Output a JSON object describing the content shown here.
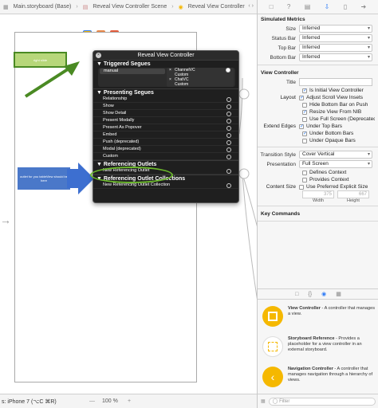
{
  "jumpbar": {
    "crumbs": [
      "Main.storyboard (Base)",
      "Reveal View Controller Scene",
      "Reveal View Controller"
    ]
  },
  "canvas": {
    "note_green": "right slide",
    "note_blue": "outlet for you tableView should be here"
  },
  "hud": {
    "title": "Reveal View Controller",
    "triggered_title": "Triggered Segues",
    "manual_label": "manual",
    "manual_targets": [
      {
        "mark": "×",
        "label": "ChannelVC"
      },
      {
        "mark": "",
        "label": "Custom"
      },
      {
        "mark": "×",
        "label": "ChatVC"
      },
      {
        "mark": "",
        "label": "Custom"
      }
    ],
    "presenting_title": "Presenting Segues",
    "presenting_items": [
      "Relationship",
      "Show",
      "Show Detail",
      "Present Modally",
      "Present As Popover",
      "Embed",
      "Push (deprecated)",
      "Modal (deprecated)",
      "Custom"
    ],
    "outlets_title": "Referencing Outlets",
    "outlets_items": [
      "New Referencing Outlet"
    ],
    "collections_title": "Referencing Outlet Collections",
    "collections_items": [
      "New Referencing Outlet Collection"
    ]
  },
  "bottombar": {
    "device": "s: iPhone 7 (⌥C ⌘R)",
    "zoom_out": "—",
    "zoom": "100 %",
    "zoom_in": "+"
  },
  "inspector": {
    "simulated_title": "Simulated Metrics",
    "metrics": [
      {
        "label": "Size",
        "value": "Inferred"
      },
      {
        "label": "Status Bar",
        "value": "Inferred"
      },
      {
        "label": "Top Bar",
        "value": "Inferred"
      },
      {
        "label": "Bottom Bar",
        "value": "Inferred"
      }
    ],
    "vc_title": "View Controller",
    "title_label": "Title",
    "is_initial": "Is Initial View Controller",
    "layout_label": "Layout",
    "layout_checks": [
      {
        "label": "Adjust Scroll View Insets",
        "checked": true
      },
      {
        "label": "Hide Bottom Bar on Push",
        "checked": false
      },
      {
        "label": "Resize View From NIB",
        "checked": true
      },
      {
        "label": "Use Full Screen (Deprecated)",
        "checked": false
      }
    ],
    "extend_label": "Extend Edges",
    "extend_checks": [
      {
        "label": "Under Top Bars",
        "checked": true
      },
      {
        "label": "Under Bottom Bars",
        "checked": true
      },
      {
        "label": "Under Opaque Bars",
        "checked": false
      }
    ],
    "transition_label": "Transition Style",
    "transition_value": "Cover Vertical",
    "presentation_label": "Presentation",
    "presentation_value": "Full Screen",
    "defines_context": "Defines Context",
    "provides_context": "Provides Context",
    "content_size_label": "Content Size",
    "use_preferred": "Use Preferred Explicit Size",
    "width_value": "375",
    "height_value": "667",
    "width_label": "Width",
    "height_label": "Height",
    "key_commands_title": "Key Commands"
  },
  "library": {
    "items": [
      {
        "name": "View Controller",
        "desc": " - A controller that manages a view."
      },
      {
        "name": "Storyboard Reference",
        "desc": " - Provides a placeholder for a view controller in an external storyboard."
      },
      {
        "name": "Navigation Controller",
        "desc": " - A controller that manages navigation through a hierarchy of views."
      }
    ],
    "filter_placeholder": "Filter"
  },
  "colors": {
    "hud_bg": "#1f1f1f",
    "highlight_green": "#6bb82c",
    "arrow_blue": "#3d6fd0",
    "accent": "#2f7cf6",
    "library_yellow": "#f5b800"
  }
}
